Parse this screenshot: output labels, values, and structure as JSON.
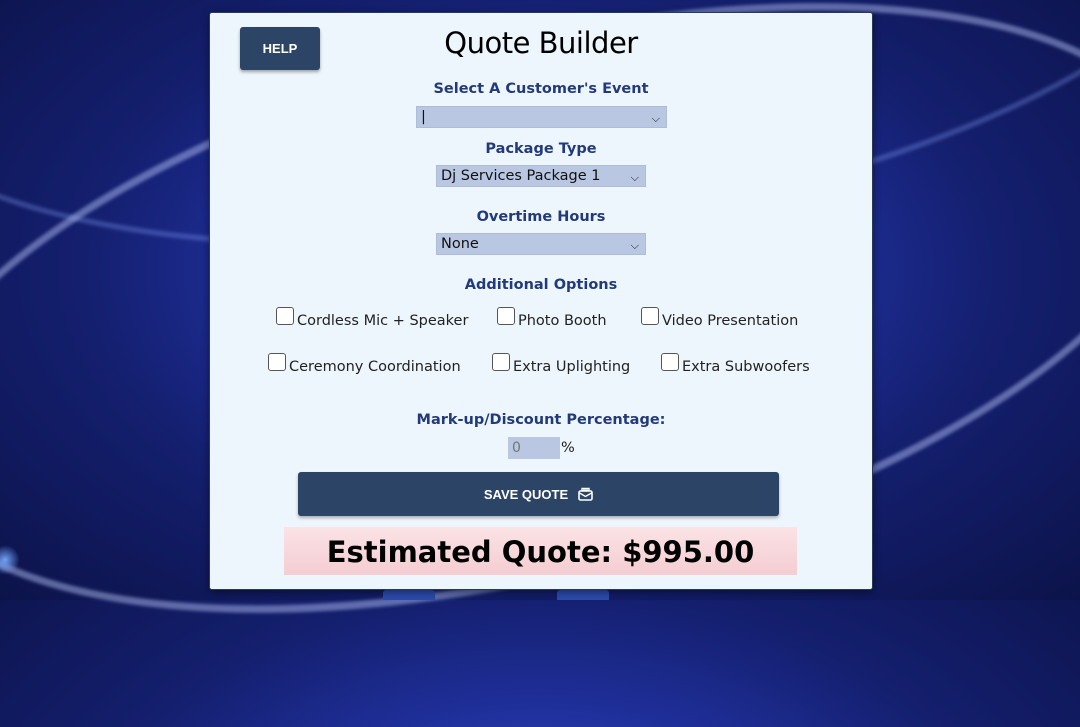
{
  "app": {
    "title": "Quote Builder",
    "help_label": "HELP"
  },
  "customer_event": {
    "label": "Select A Customer's Event",
    "value": "|"
  },
  "package_type": {
    "label": "Package Type",
    "value": "Dj Services Package 1"
  },
  "overtime_hours": {
    "label": "Overtime Hours",
    "value": "None"
  },
  "additional_options": {
    "label": "Additional Options",
    "items": [
      {
        "label": "Cordless Mic + Speaker",
        "checked": false
      },
      {
        "label": "Photo Booth",
        "checked": false
      },
      {
        "label": "Video Presentation",
        "checked": false
      },
      {
        "label": "Ceremony Coordination",
        "checked": false
      },
      {
        "label": "Extra Uplighting",
        "checked": false
      },
      {
        "label": "Extra Subwoofers",
        "checked": false
      }
    ]
  },
  "markup": {
    "label": "Mark-up/Discount Percentage:",
    "placeholder": "0",
    "unit": "%"
  },
  "save_label": "SAVE QUOTE",
  "estimate": {
    "text": "Estimated Quote: $995.00"
  },
  "colors": {
    "button": "#2c4465",
    "label": "#233a7a",
    "select_bg": "#b9c7e2",
    "card_bg": "#eef6fd"
  }
}
